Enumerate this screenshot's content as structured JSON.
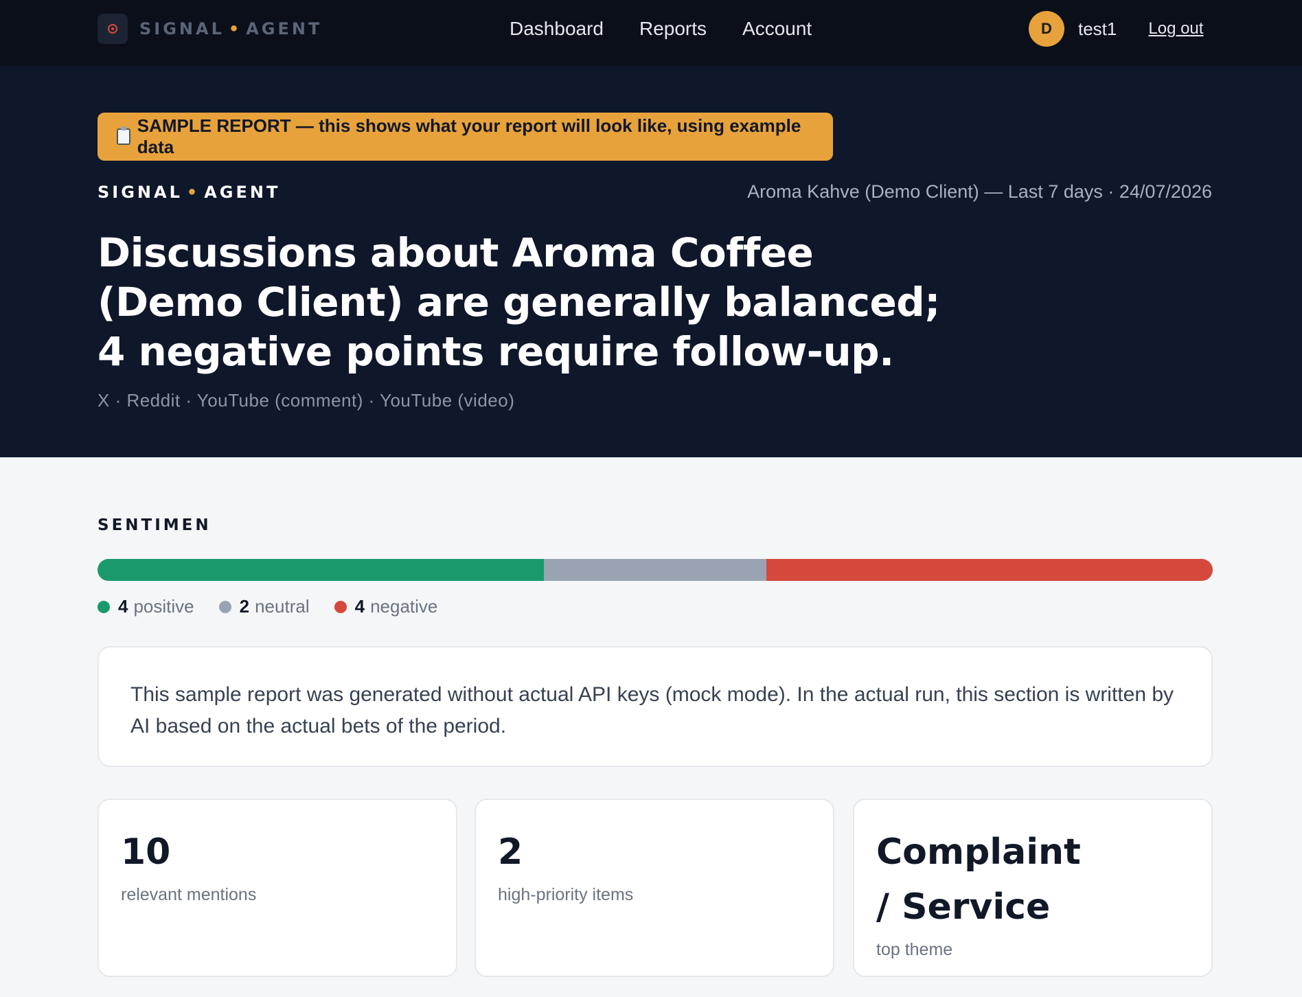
{
  "nav": {
    "brand_left": "SIGNAL",
    "brand_sep": "•",
    "brand_right": "AGENT",
    "links": [
      "Dashboard",
      "Reports",
      "Account"
    ],
    "avatar_initial": "D",
    "username": "test1",
    "logout_label": "Log out"
  },
  "hero": {
    "banner_icon": "clipboard-icon",
    "banner_text": "SAMPLE REPORT — this shows what your report will look like, using example data",
    "brand_left": "SIGNAL",
    "brand_sep": "•",
    "brand_right": "AGENT",
    "meta": "Aroma Kahve (Demo Client) — Last 7 days · 24/07/2026",
    "headline": "Discussions about Aroma Coffee (Demo Client) are generally balanced; 4 negative points require follow-up.",
    "sources": "X · Reddit · YouTube (comment) · YouTube (video)"
  },
  "sentiment": {
    "label": "SENTIMEN",
    "positive": {
      "count": "4",
      "label": "positive",
      "value": 4,
      "color": "#1a9a6c"
    },
    "neutral": {
      "count": "2",
      "label": "neutral",
      "value": 2,
      "color": "#9aa3b2"
    },
    "negative": {
      "count": "4",
      "label": "negative",
      "value": 4,
      "color": "#d5483c"
    }
  },
  "summary": {
    "text": "This sample report was generated without actual API keys (mock mode). In the actual run, this section is written by AI based on the actual bets of the period."
  },
  "stats": [
    {
      "value": "10",
      "label": "relevant mentions"
    },
    {
      "value": "2",
      "label": "high-priority items"
    },
    {
      "value": "Complaint / Service",
      "label": "top theme"
    }
  ],
  "colors": {
    "accent": "#e8a23b",
    "nav_bg": "#0a0f1a",
    "hero_bg": "#0f172a"
  }
}
